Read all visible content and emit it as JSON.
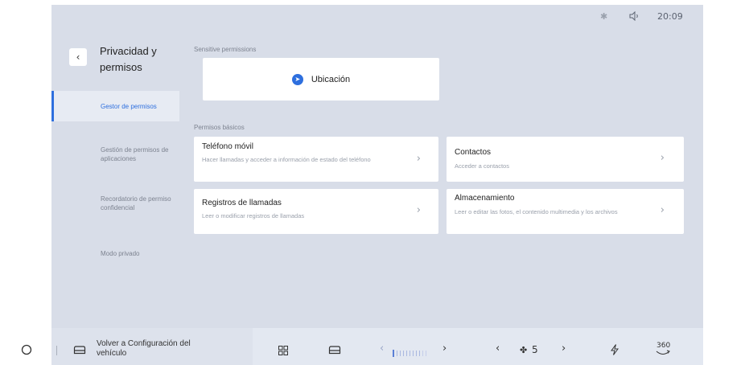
{
  "status_bar": {
    "time": "20:09",
    "icons": [
      "bluetooth-icon",
      "volume-icon"
    ]
  },
  "header": {
    "title": "Privacidad y permisos",
    "back_icon": "chevron-left-icon"
  },
  "nav": {
    "items": [
      {
        "label": "Gestor de permisos",
        "active": true
      },
      {
        "label": "Gestión de permisos de aplicaciones",
        "active": false
      },
      {
        "label": "Recordatorio de permiso confidencial",
        "active": false
      },
      {
        "label": "Modo privado",
        "active": false
      }
    ]
  },
  "sensitive": {
    "label": "Sensitive permissions",
    "items": [
      {
        "label": "Ubicación",
        "icon": "location-arrow-icon"
      }
    ]
  },
  "basic": {
    "label": "Permisos básicos",
    "cards": [
      {
        "title": "Teléfono móvil",
        "desc": "Hacer llamadas y acceder a información de estado del teléfono"
      },
      {
        "title": "Contactos",
        "desc": "Acceder a contactos"
      },
      {
        "title": "Registros de llamadas",
        "desc": "Leer o modificar registros de llamadas"
      },
      {
        "title": "Almacenamiento",
        "desc": "Leer o editar las fotos, el contenido multimedia y los archivos"
      }
    ]
  },
  "dock": {
    "home_icon": "circle-home-icon",
    "car_label": "Volver a Configuración del vehículo",
    "fan_speed": "5",
    "view_label": "360",
    "accent": "#2e6fde"
  }
}
